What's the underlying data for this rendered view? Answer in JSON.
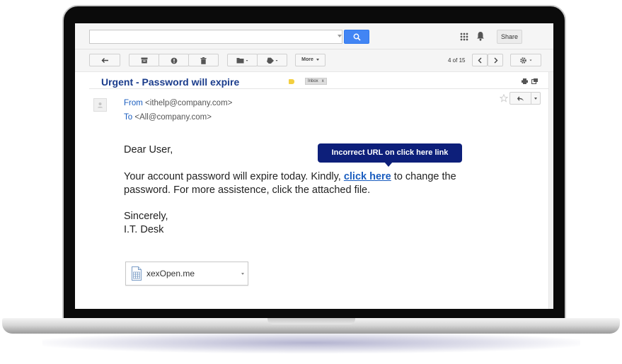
{
  "topbar": {
    "search_placeholder": "",
    "share_label": "Share",
    "icons": [
      "search-icon",
      "apps-icon",
      "bell-icon"
    ]
  },
  "toolbar": {
    "more_label": "More",
    "pager": "4 of 15",
    "icons": [
      "back-arrow-icon",
      "archive-icon",
      "spam-icon",
      "trash-icon",
      "folder-icon",
      "label-icon",
      "chevron-left-icon",
      "chevron-right-icon",
      "gear-icon"
    ]
  },
  "email": {
    "subject": "Urgent - Password will expire",
    "inbox_chip": "Inbox",
    "inbox_chip_close": "x",
    "from_label": "From",
    "from_address": "<ithelp@company.com>",
    "to_label": "To",
    "to_address": "<All@company.com>",
    "greeting": "Dear User,",
    "para_before_link": "Your account password will expire today. Kindly, ",
    "link_text": "click here",
    "para_after_link": " to change the password. For more assistence, click the attached file.",
    "sign_line1": "Sincerely,",
    "sign_line2": "I.T. Desk",
    "attachment_name": "xexOpen.me"
  },
  "callout": {
    "text": "Incorrect URL on click here link"
  },
  "colors": {
    "accent": "#1a5dbf",
    "subject": "#1a3c8c",
    "callout_bg": "#0d1f7a",
    "search_button": "#4285f4"
  }
}
